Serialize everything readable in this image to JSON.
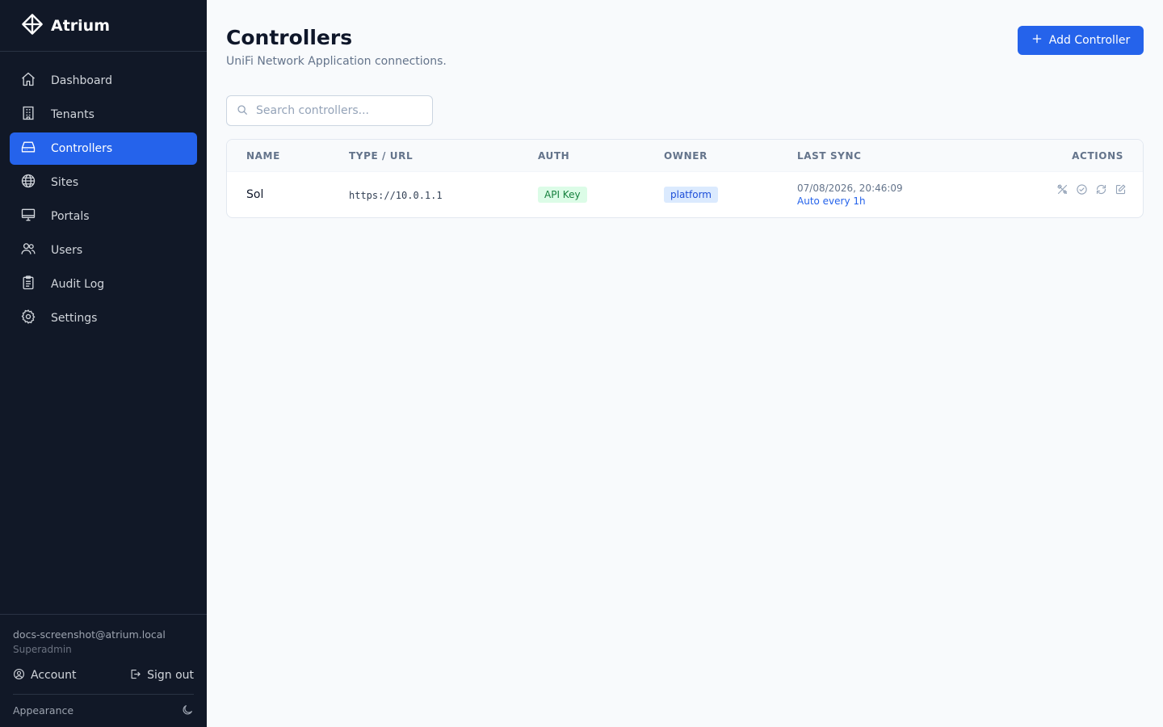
{
  "app": {
    "name": "Atrium",
    "logo_icon": "diamond-crosshair-icon"
  },
  "sidebar": {
    "items": [
      {
        "label": "Dashboard",
        "icon": "home-icon",
        "active": false
      },
      {
        "label": "Tenants",
        "icon": "building-icon",
        "active": false
      },
      {
        "label": "Controllers",
        "icon": "hard-drive-icon",
        "active": true
      },
      {
        "label": "Sites",
        "icon": "globe-icon",
        "active": false
      },
      {
        "label": "Portals",
        "icon": "monitor-icon",
        "active": false
      },
      {
        "label": "Users",
        "icon": "users-icon",
        "active": false
      },
      {
        "label": "Audit Log",
        "icon": "clipboard-list-icon",
        "active": false
      },
      {
        "label": "Settings",
        "icon": "gear-icon",
        "active": false
      }
    ],
    "user": {
      "email": "docs-screenshot@atrium.local",
      "role": "Superadmin",
      "account_label": "Account",
      "signout_label": "Sign out"
    },
    "appearance_label": "Appearance"
  },
  "page": {
    "title": "Controllers",
    "subtitle": "UniFi Network Application connections.",
    "add_button_label": "Add Controller",
    "search": {
      "placeholder": "Search controllers...",
      "value": ""
    }
  },
  "table": {
    "columns": [
      "NAME",
      "TYPE / URL",
      "AUTH",
      "OWNER",
      "LAST SYNC",
      "ACTIONS"
    ],
    "rows": [
      {
        "name": "Sol",
        "url": "https://10.0.1.1",
        "auth": "API Key",
        "owner": "platform",
        "last_sync": "07/08/2026, 20:46:09",
        "sync_schedule": "Auto every 1h",
        "actions": [
          "tools-icon",
          "check-circle-icon",
          "refresh-icon",
          "edit-icon"
        ]
      }
    ]
  },
  "colors": {
    "sidebar_bg": "#111827",
    "accent": "#2563eb",
    "page_bg": "#f8fafc",
    "auth_badge_bg": "#dcfce7",
    "auth_badge_text": "#15803d",
    "owner_badge_bg": "#dbeafe",
    "owner_badge_text": "#1d4ed8"
  }
}
